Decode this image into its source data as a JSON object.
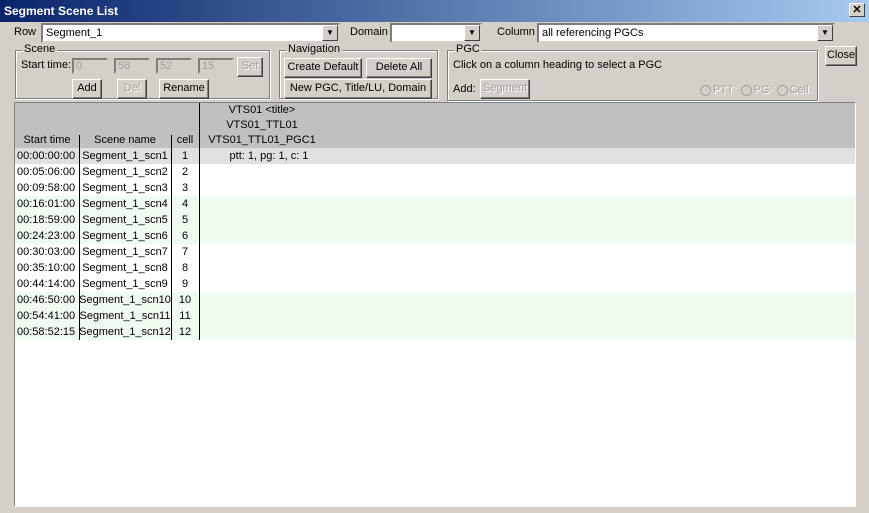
{
  "window": {
    "title": "Segment Scene List",
    "close_glyph": "✕"
  },
  "toolbar": {
    "row_label": "Row",
    "row_value": "Segment_1",
    "domain_label": "Domain",
    "domain_value": "",
    "column_label": "Column",
    "column_value": "all referencing PGCs",
    "close_label": "Close"
  },
  "scene": {
    "legend": "Scene",
    "start_time_label": "Start time:",
    "h": "0",
    "m": "58",
    "s": "52",
    "f": "15",
    "set_label": "Set",
    "add_label": "Add",
    "del_label": "Del",
    "rename_label": "Rename"
  },
  "navigation": {
    "legend": "Navigation",
    "create_default": "Create Default",
    "delete_all": "Delete All",
    "new_pgc": "New PGC, Title/LU, Domain"
  },
  "pgc": {
    "legend": "PGC",
    "hint": "Click on a column heading to select a PGC",
    "add_label": "Add:",
    "segment_label": "Segment",
    "radios": [
      "PTT",
      "PG",
      "Cell"
    ]
  },
  "table": {
    "headers": {
      "start": "Start time",
      "name": "Scene name",
      "cell": "cell",
      "pgc_line1": "VTS01 <title>",
      "pgc_line2": "VTS01_TTL01",
      "pgc_line3": "VTS01_TTL01_PGC1"
    },
    "rows": [
      {
        "start": "00:00:00:00",
        "name": "Segment_1_scn1",
        "cell": "1",
        "pgc": "ptt: 1, pg: 1, c: 1"
      },
      {
        "start": "00:05:06:00",
        "name": "Segment_1_scn2",
        "cell": "2",
        "pgc": ""
      },
      {
        "start": "00:09:58:00",
        "name": "Segment_1_scn3",
        "cell": "3",
        "pgc": ""
      },
      {
        "start": "00:16:01:00",
        "name": "Segment_1_scn4",
        "cell": "4",
        "pgc": ""
      },
      {
        "start": "00:18:59:00",
        "name": "Segment_1_scn5",
        "cell": "5",
        "pgc": ""
      },
      {
        "start": "00:24:23:00",
        "name": "Segment_1_scn6",
        "cell": "6",
        "pgc": ""
      },
      {
        "start": "00:30:03:00",
        "name": "Segment_1_scn7",
        "cell": "7",
        "pgc": ""
      },
      {
        "start": "00:35:10:00",
        "name": "Segment_1_scn8",
        "cell": "8",
        "pgc": ""
      },
      {
        "start": "00:44:14:00",
        "name": "Segment_1_scn9",
        "cell": "9",
        "pgc": ""
      },
      {
        "start": "00:46:50:00",
        "name": "Segment_1_scn10",
        "cell": "10",
        "pgc": ""
      },
      {
        "start": "00:54:41:00",
        "name": "Segment_1_scn11",
        "cell": "11",
        "pgc": ""
      },
      {
        "start": "00:58:52:15",
        "name": "Segment_1_scn12",
        "cell": "12",
        "pgc": ""
      }
    ]
  },
  "colors": {
    "selected_row": "#e0e0e0",
    "alt_row": "#eefbee",
    "header": "#c0c0c0"
  }
}
